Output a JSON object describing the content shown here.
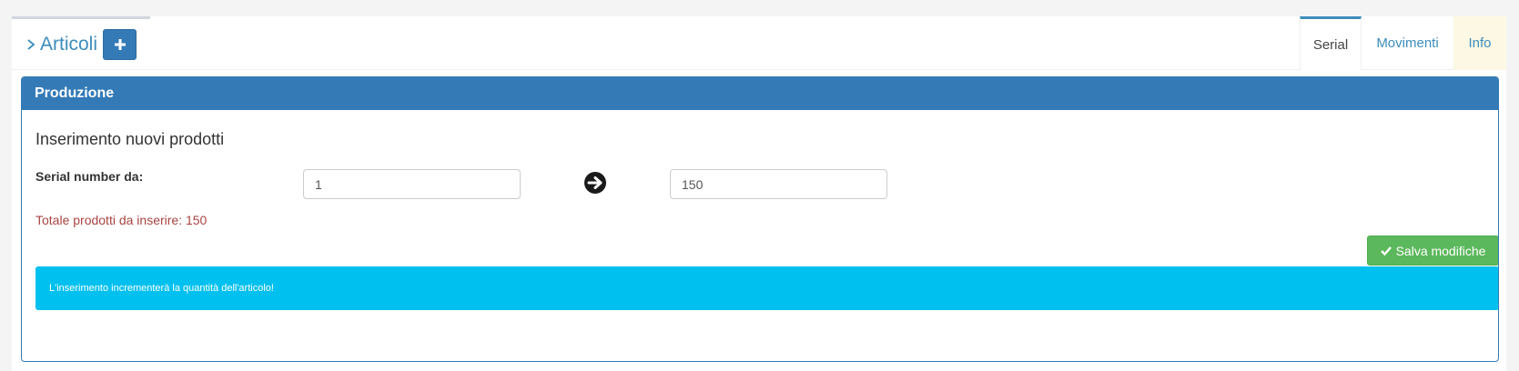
{
  "header": {
    "title": "Articoli",
    "add_icon": "plus-icon",
    "chevron_icon": "chevron-right-icon"
  },
  "tabs": [
    {
      "label": "Serial",
      "active": true
    },
    {
      "label": "Movimenti",
      "active": false
    },
    {
      "label": "Info",
      "active": false
    }
  ],
  "panel": {
    "heading": "Produzione",
    "section_title": "Inserimento nuovi prodotti",
    "serial_label": "Serial number da:",
    "serial_from": "1",
    "serial_to": "150",
    "arrow_icon": "arrow-right-circle-icon",
    "total_text": "Totale prodotti da inserire: 150",
    "save_label": "Salva modifiche",
    "save_icon": "check-icon",
    "alert_text": "L'inserimento incrementerà la quantità dell'articolo!"
  },
  "colors": {
    "primary": "#337ab7",
    "link": "#3c8dbc",
    "success": "#5cb85c",
    "info": "#00c0ef",
    "danger_text": "#a94442",
    "info_tab_bg": "#fcf8e3"
  }
}
